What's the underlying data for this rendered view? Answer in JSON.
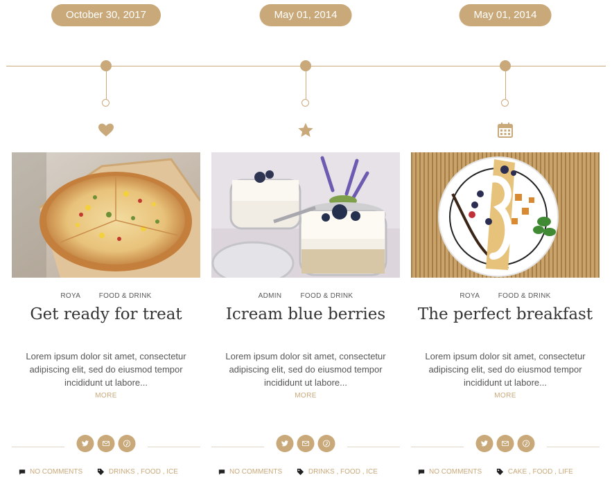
{
  "accent_color": "#c9a97a",
  "posts": [
    {
      "date": "October 30, 2017",
      "type_icon": "heart-icon",
      "image": "pizza",
      "author": "ROYA",
      "category": "FOOD & DRINK",
      "title": "Get ready for treat",
      "excerpt": "Lorem ipsum dolor sit amet, consectetur adipiscing elit, sed do eiusmod tempor incididunt ut labore...",
      "more": "MORE",
      "comments": "NO COMMENTS",
      "tags": [
        "DRINKS",
        "FOOD",
        "ICE"
      ]
    },
    {
      "date": "May 01, 2014",
      "type_icon": "star-icon",
      "image": "yogurt jars with blueberries",
      "author": "ADMIN",
      "category": "FOOD & DRINK",
      "title": "Icream blue berries",
      "excerpt": "Lorem ipsum dolor sit amet, consectetur adipiscing elit, sed do eiusmod tempor incididunt ut labore...",
      "more": "MORE",
      "comments": "NO COMMENTS",
      "tags": [
        "DRINKS",
        "FOOD",
        "ICE"
      ]
    },
    {
      "date": "May 01, 2014",
      "type_icon": "calendar-icon",
      "image": "crepe breakfast plate",
      "author": "ROYA",
      "category": "FOOD & DRINK",
      "title": "The perfect breakfast",
      "excerpt": "Lorem ipsum dolor sit amet, consectetur adipiscing elit, sed do eiusmod tempor incididunt ut labore...",
      "more": "MORE",
      "comments": "NO COMMENTS",
      "tags": [
        "CAKE",
        "FOOD",
        "LIFE"
      ]
    }
  ],
  "share_icons": [
    "twitter-icon",
    "email-icon",
    "pinterest-icon"
  ]
}
